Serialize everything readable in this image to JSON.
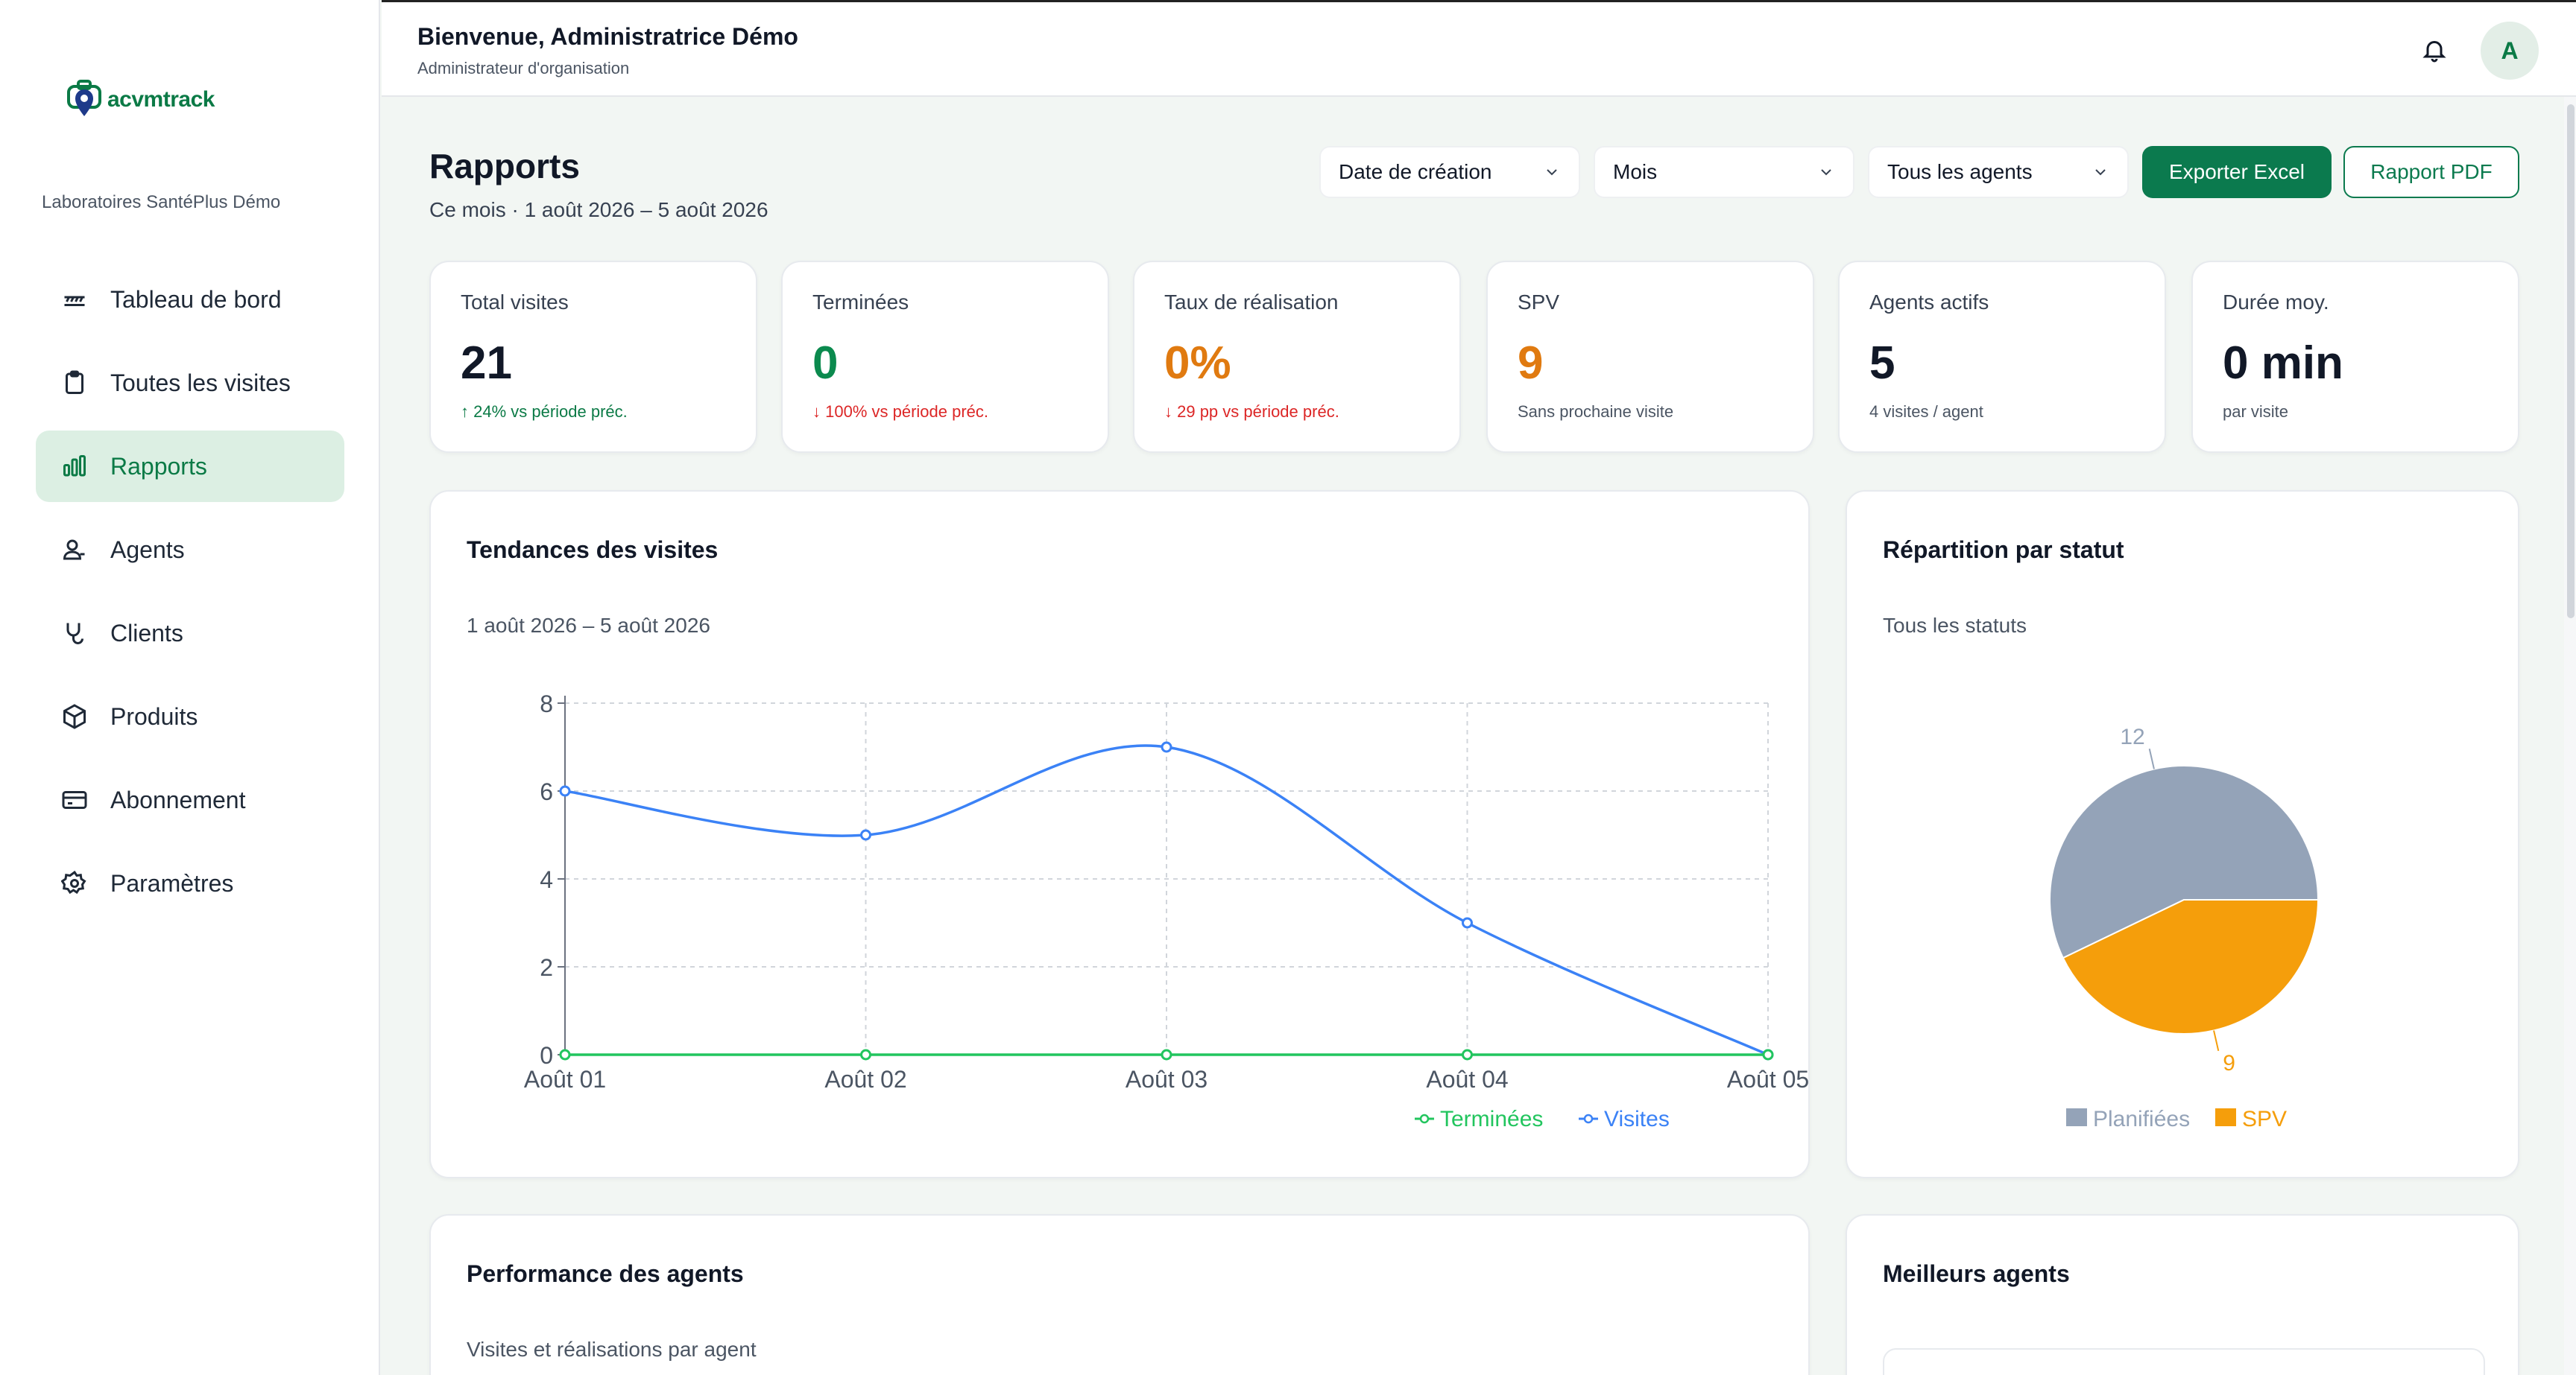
{
  "sidebar": {
    "logo_text": "acvmtrack",
    "org_name": "Laboratoires SantéPlus Démo",
    "items": [
      {
        "label": "Tableau de bord",
        "icon": "dashboard-icon"
      },
      {
        "label": "Toutes les visites",
        "icon": "clipboard-icon"
      },
      {
        "label": "Rapports",
        "icon": "bar-chart-icon",
        "active": true
      },
      {
        "label": "Agents",
        "icon": "user-icon"
      },
      {
        "label": "Clients",
        "icon": "stethoscope-icon"
      },
      {
        "label": "Produits",
        "icon": "box-icon"
      },
      {
        "label": "Abonnement",
        "icon": "credit-card-icon"
      },
      {
        "label": "Paramètres",
        "icon": "gear-icon"
      }
    ]
  },
  "header": {
    "welcome": "Bienvenue, Administratrice Démo",
    "role": "Administrateur d'organisation",
    "avatar_initial": "A"
  },
  "page": {
    "title": "Rapports",
    "subtitle": "Ce mois · 1 août 2026 – 5 août 2026"
  },
  "filters": {
    "date_field": "Date de création",
    "period": "Mois",
    "agents": "Tous les agents"
  },
  "actions": {
    "export_excel": "Exporter Excel",
    "report_pdf": "Rapport PDF"
  },
  "kpis": [
    {
      "label": "Total visites",
      "value": "21",
      "sub": "↑ 24% vs période préc.",
      "value_color": "#111827",
      "sub_color": "#0b7a46"
    },
    {
      "label": "Terminées",
      "value": "0",
      "sub": "↓ 100% vs période préc.",
      "value_color": "#0b8a4e",
      "sub_color": "#dc2626"
    },
    {
      "label": "Taux de réalisation",
      "value": "0%",
      "sub": "↓ 29 pp vs période préc.",
      "value_color": "#e07a10",
      "sub_color": "#dc2626"
    },
    {
      "label": "SPV",
      "value": "9",
      "sub": "Sans prochaine visite",
      "value_color": "#e07a10",
      "sub_color": "#4b5563"
    },
    {
      "label": "Agents actifs",
      "value": "5",
      "sub": "4 visites / agent",
      "value_color": "#111827",
      "sub_color": "#4b5563"
    },
    {
      "label": "Durée moy.",
      "value": "0 min",
      "sub": "par visite",
      "value_color": "#111827",
      "sub_color": "#4b5563"
    }
  ],
  "trend_card": {
    "title": "Tendances des visites",
    "subtitle": "1 août 2026 – 5 août 2026"
  },
  "status_card": {
    "title": "Répartition par statut",
    "subtitle": "Tous les statuts"
  },
  "agents_card": {
    "title": "Performance des agents",
    "subtitle": "Visites et réalisations par agent"
  },
  "best_card": {
    "title": "Meilleurs agents"
  },
  "chart_data": [
    {
      "type": "line",
      "categories": [
        "Août 01",
        "Août 02",
        "Août 03",
        "Août 04",
        "Août 05"
      ],
      "series": [
        {
          "name": "Terminées",
          "values": [
            0,
            0,
            0,
            0,
            0
          ],
          "color": "#22c55e"
        },
        {
          "name": "Visites",
          "values": [
            6,
            5,
            7,
            3,
            0
          ],
          "color": "#3b82f6"
        }
      ],
      "yticks": [
        0,
        2,
        4,
        6,
        8
      ],
      "ylim": [
        0,
        8
      ],
      "grid": true,
      "legend": "bottom"
    },
    {
      "type": "pie",
      "slices": [
        {
          "name": "Planifiées",
          "value": 12,
          "color": "#94a3b8"
        },
        {
          "name": "SPV",
          "value": 9,
          "color": "#f59e0b"
        }
      ],
      "legend": "bottom"
    }
  ]
}
